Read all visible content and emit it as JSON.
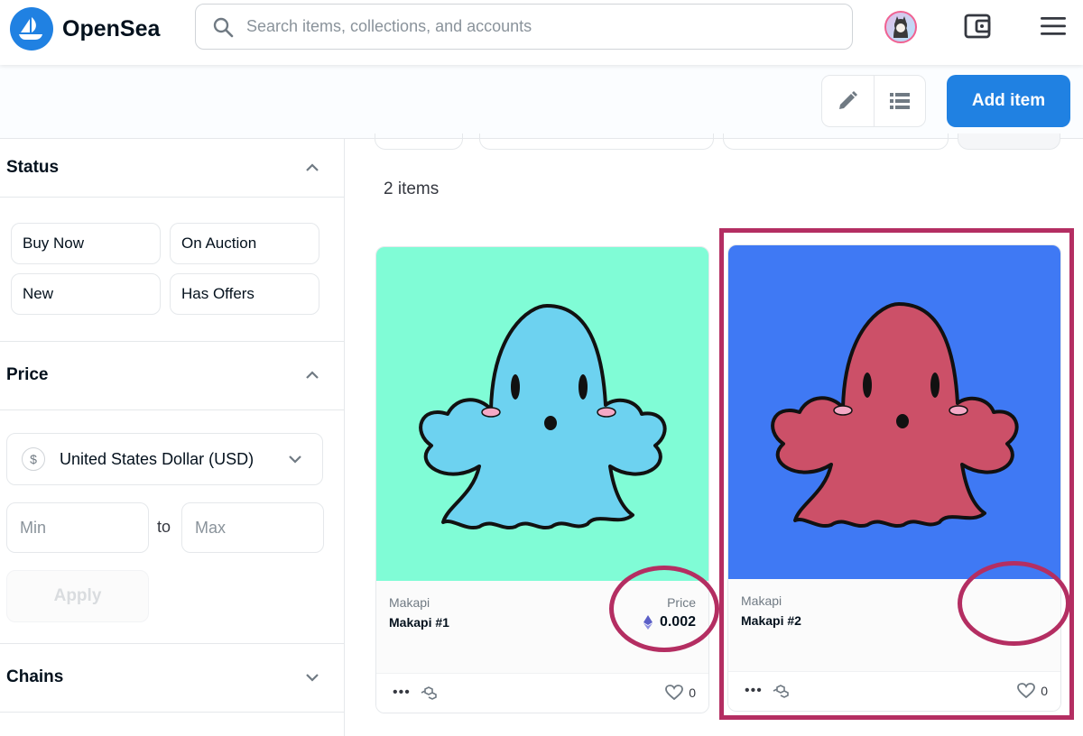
{
  "header": {
    "brand": "OpenSea",
    "search_placeholder": "Search items, collections, and accounts"
  },
  "toolbar": {
    "add_item_label": "Add item"
  },
  "sidebar": {
    "status": {
      "title": "Status",
      "filters": [
        "Buy Now",
        "On Auction",
        "New",
        "Has Offers"
      ]
    },
    "price": {
      "title": "Price",
      "currency": "United States Dollar (USD)",
      "currency_symbol": "$",
      "min_placeholder": "Min",
      "to_label": "to",
      "max_placeholder": "Max",
      "apply_label": "Apply"
    },
    "chains": {
      "title": "Chains"
    }
  },
  "main": {
    "item_count": "2 items",
    "items": [
      {
        "collection": "Makapi",
        "name": "Makapi #1",
        "price_label": "Price",
        "price": "0.002",
        "likes": "0",
        "background": "#80fcd6",
        "ghost_color": "#6dd2f0"
      },
      {
        "collection": "Makapi",
        "name": "Makapi #2",
        "likes": "0",
        "background": "#3f79f4",
        "ghost_color": "#cc5068"
      }
    ]
  },
  "colors": {
    "brand": "#2081e2",
    "highlight": "#b42e62"
  }
}
